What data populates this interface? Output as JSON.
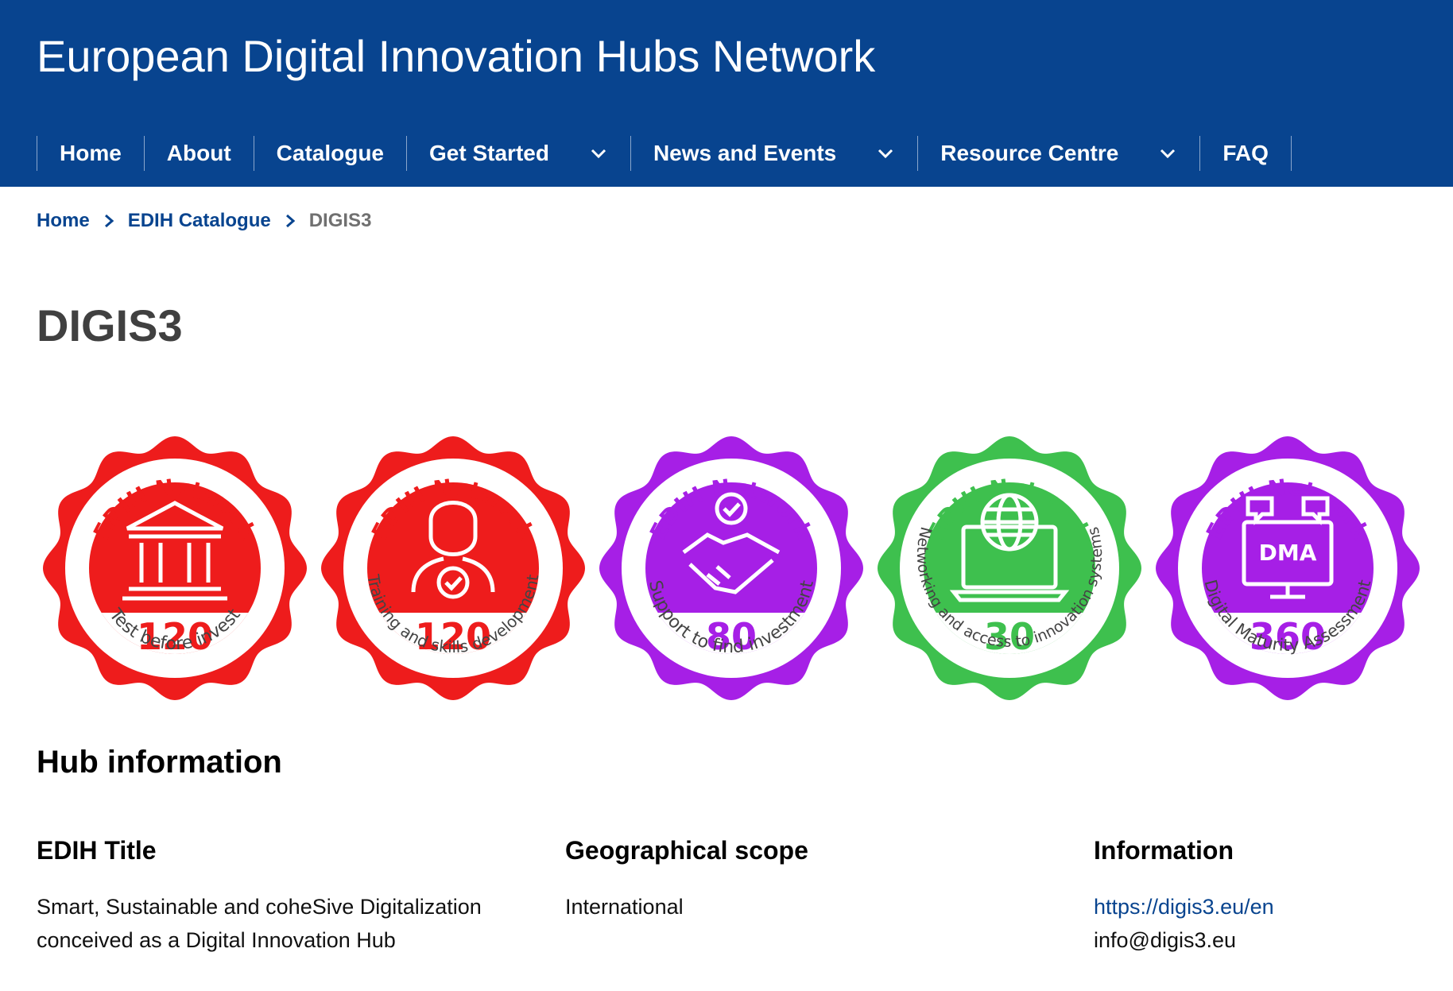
{
  "header": {
    "site_title": "European Digital Innovation Hubs Network"
  },
  "nav": {
    "items": [
      {
        "label": "Home"
      },
      {
        "label": "About"
      },
      {
        "label": "Catalogue"
      },
      {
        "label": "Get Started"
      },
      {
        "label": "News and Events"
      },
      {
        "label": "Resource Centre"
      },
      {
        "label": "FAQ"
      }
    ]
  },
  "breadcrumb": {
    "items": [
      {
        "label": "Home"
      },
      {
        "label": "EDIH Catalogue"
      },
      {
        "label": "DIGIS3"
      }
    ]
  },
  "page": {
    "title": "DIGIS3"
  },
  "badges": [
    {
      "top_text": "EDIH Network",
      "number": "120",
      "caption": "Test before invest",
      "color": "#ee1c1c",
      "icon": "bank-icon"
    },
    {
      "top_text": "EDIH Network",
      "number": "120",
      "caption": "Training and skills development",
      "color": "#ee1c1c",
      "icon": "person-check-icon"
    },
    {
      "top_text": "EDIH Network",
      "number": "80",
      "caption": "Support to find investment",
      "color": "#a61fe6",
      "icon": "handshake-icon"
    },
    {
      "top_text": "EDIH Network",
      "number": "30",
      "caption": "Networking and access to innovation systems",
      "color": "#3ec04e",
      "icon": "laptop-globe-icon"
    },
    {
      "top_text": "EDIH Network",
      "number": "360",
      "caption": "Digital Maturity Assessment",
      "color": "#a61fe6",
      "icon": "monitor-dma-icon",
      "icon_label": "DMA"
    }
  ],
  "hub_info": {
    "section_title": "Hub information",
    "edih_title": {
      "label": "EDIH Title",
      "value_line1": "Smart, Sustainable and coheSive Digitalization",
      "value_line2": "conceived as a Digital Innovation Hub"
    },
    "geo_scope": {
      "label": "Geographical scope",
      "value": "International"
    },
    "information": {
      "label": "Information",
      "website": "https://digis3.eu/en",
      "email": "info@digis3.eu"
    }
  },
  "colors": {
    "header_bg": "#08448f",
    "link": "#08448f",
    "red": "#ee1c1c",
    "purple": "#a61fe6",
    "green": "#3ec04e"
  }
}
